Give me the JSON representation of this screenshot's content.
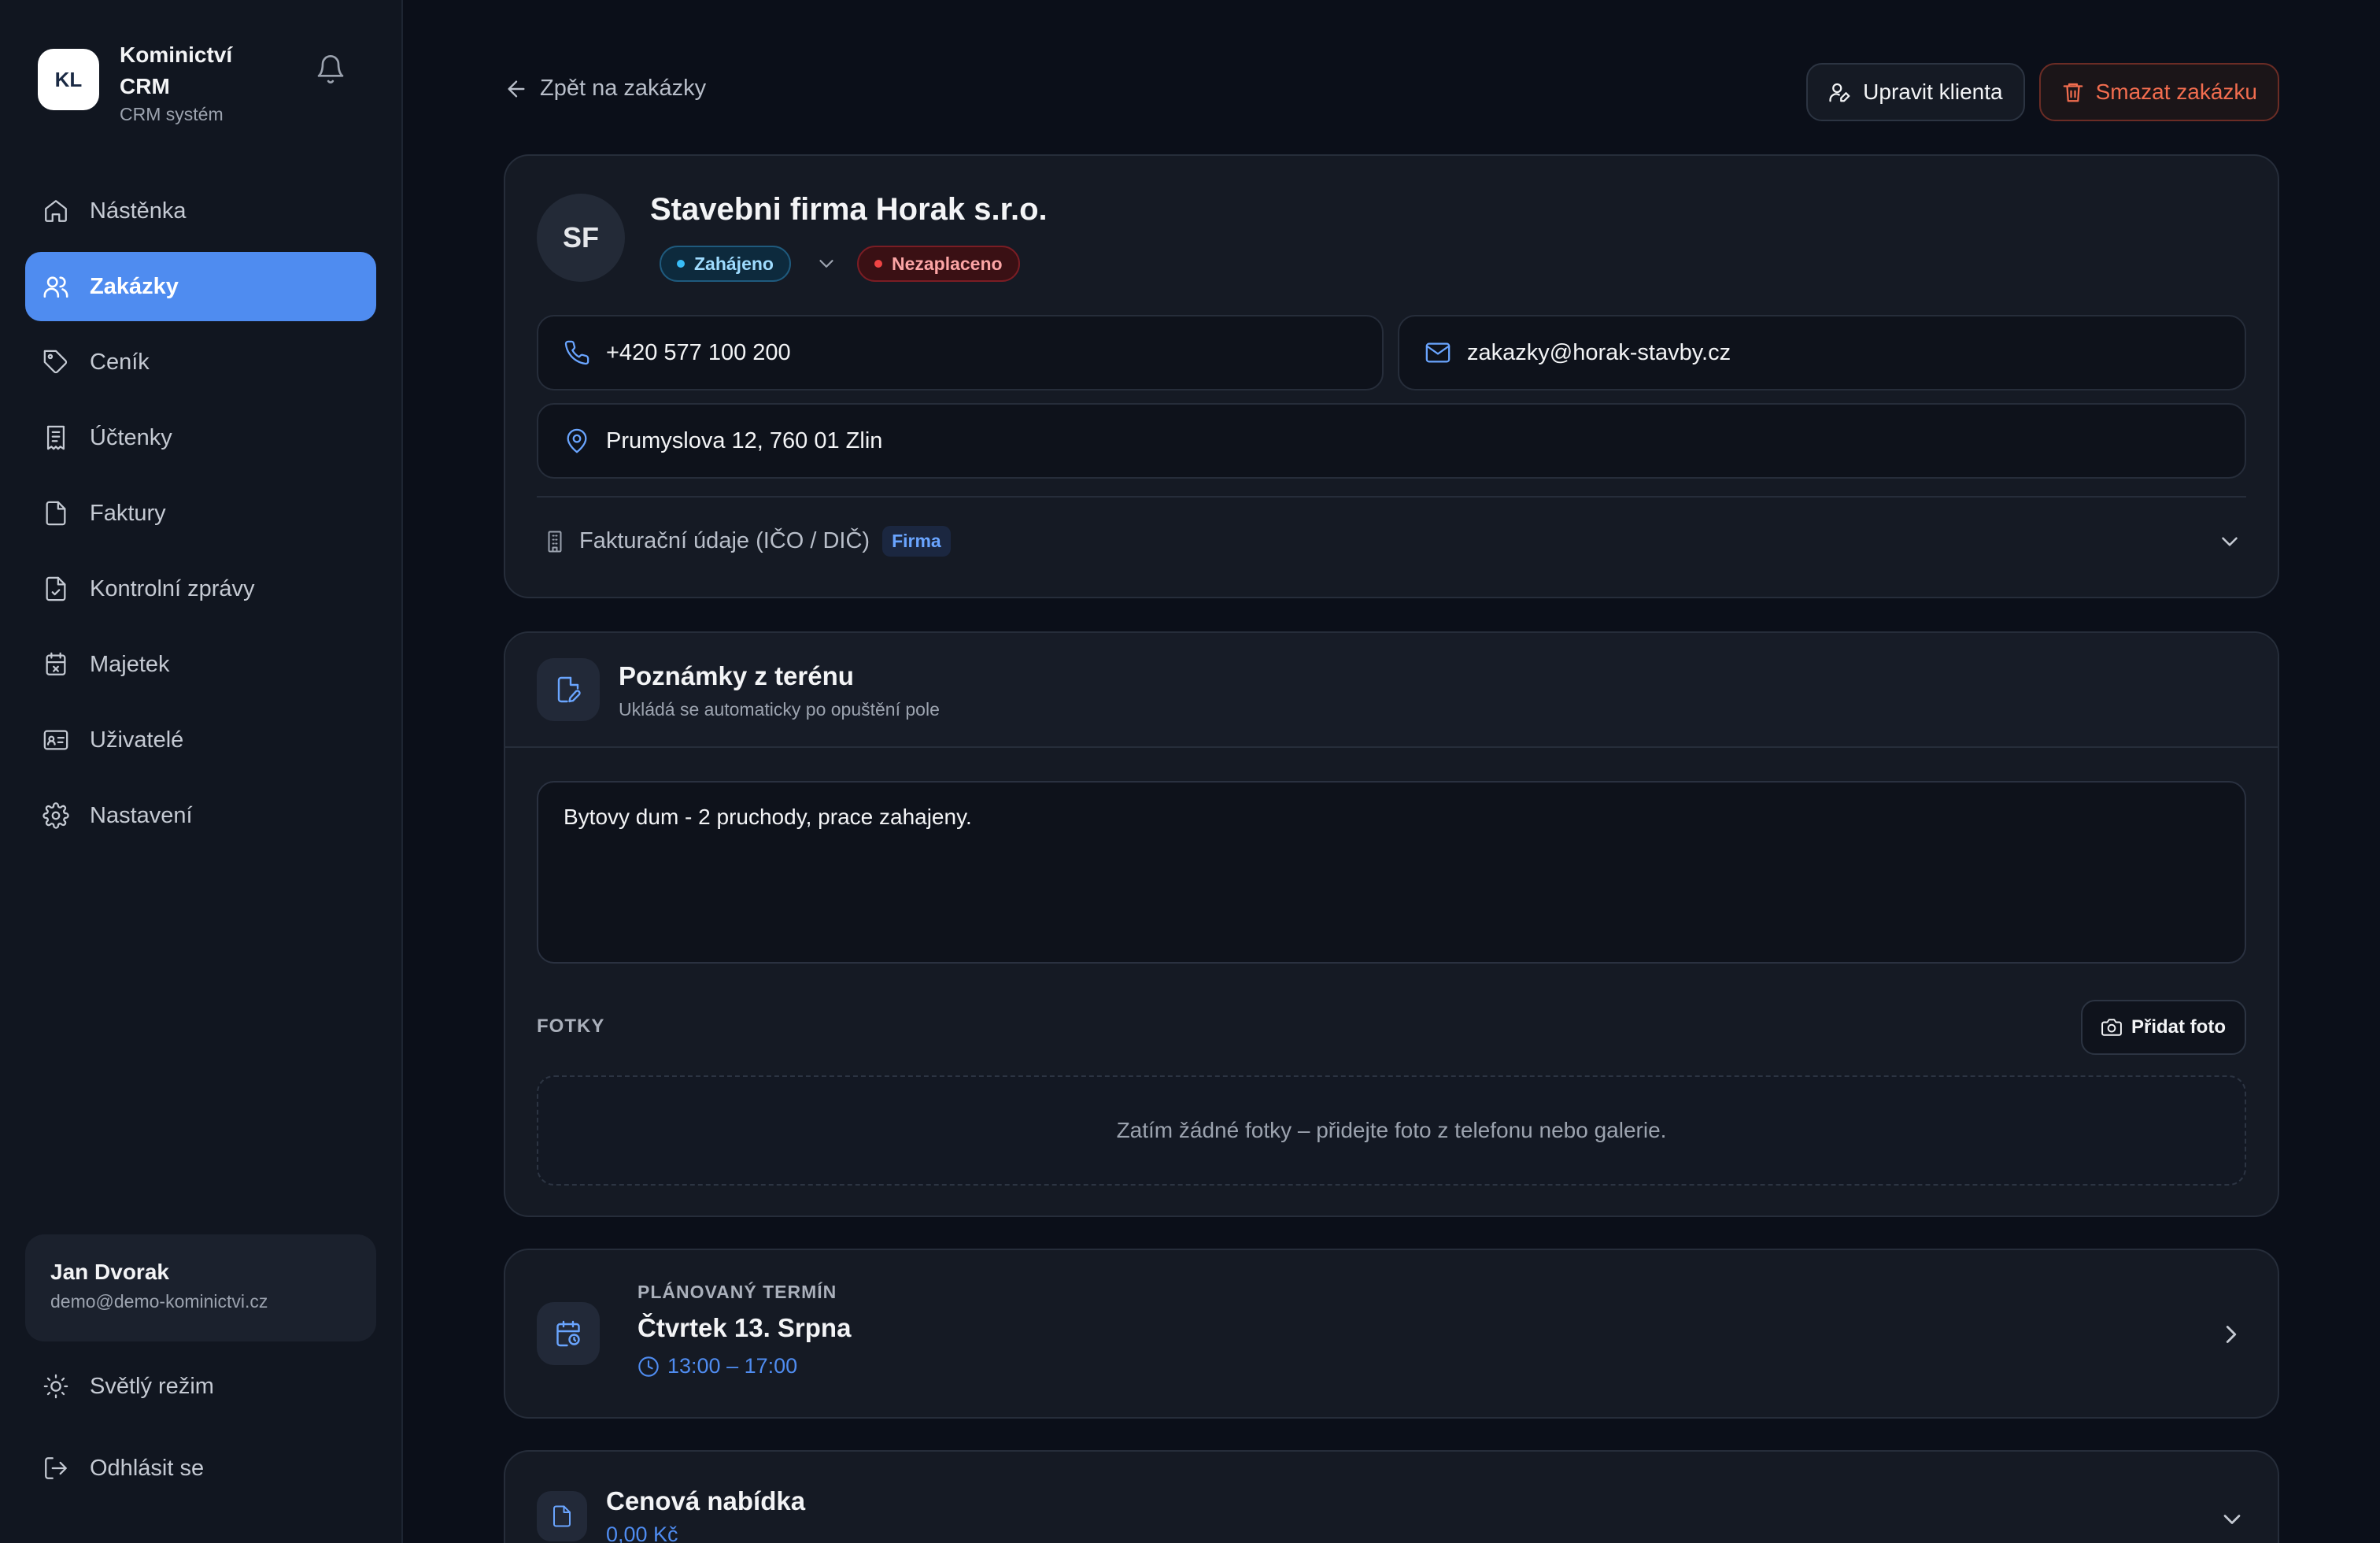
{
  "app": {
    "logo_text": "KL",
    "name": "Kominictví CRM",
    "subtitle": "CRM systém"
  },
  "sidebar": {
    "items": [
      {
        "label": "Nástěnka",
        "icon": "home-icon",
        "active": false
      },
      {
        "label": "Zakázky",
        "icon": "users-icon",
        "active": true
      },
      {
        "label": "Ceník",
        "icon": "tag-icon",
        "active": false
      },
      {
        "label": "Účtenky",
        "icon": "receipt-icon",
        "active": false
      },
      {
        "label": "Faktury",
        "icon": "file-icon",
        "active": false
      },
      {
        "label": "Kontrolní zprávy",
        "icon": "file-check-icon",
        "active": false
      },
      {
        "label": "Majetek",
        "icon": "calendar-box-icon",
        "active": false
      },
      {
        "label": "Uživatelé",
        "icon": "id-card-icon",
        "active": false
      },
      {
        "label": "Nastavení",
        "icon": "gear-icon",
        "active": false
      }
    ],
    "user": {
      "name": "Jan Dvorak",
      "email": "demo@demo-kominictvi.cz"
    },
    "theme_toggle": "Světlý režim",
    "logout": "Odhlásit se"
  },
  "header": {
    "back_label": "Zpět na zakázky",
    "edit_client_label": "Upravit klienta",
    "delete_order_label": "Smazat zakázku"
  },
  "client": {
    "initials": "SF",
    "name": "Stavebni firma Horak s.r.o.",
    "status": "Zahájeno",
    "payment_status": "Nezaplaceno",
    "phone": "+420 577 100 200",
    "email": "zakazky@horak-stavby.cz",
    "address": "Prumyslova 12, 760 01 Zlin",
    "billing_label": "Fakturační údaje (IČO / DIČ)",
    "billing_type": "Firma"
  },
  "notes": {
    "title": "Poznámky z terénu",
    "subtitle": "Ukládá se automaticky po opuštění pole",
    "text": "Bytovy dum - 2 pruchody, prace zahajeny.",
    "photos_label": "FOTKY",
    "add_photo_label": "Přidat foto",
    "empty_photos": "Zatím žádné fotky – přidejte foto z telefonu nebo galerie."
  },
  "schedule": {
    "label": "PLÁNOVANÝ TERMÍN",
    "date": "Čtvrtek 13. Srpna",
    "time": "13:00 – 17:00"
  },
  "offer": {
    "title": "Cenová nabídka",
    "price": "0,00 Kč"
  },
  "colors": {
    "accent": "#4f8cf0",
    "danger": "#f26d4f",
    "background": "#0b0f19",
    "card": "#151a24"
  }
}
